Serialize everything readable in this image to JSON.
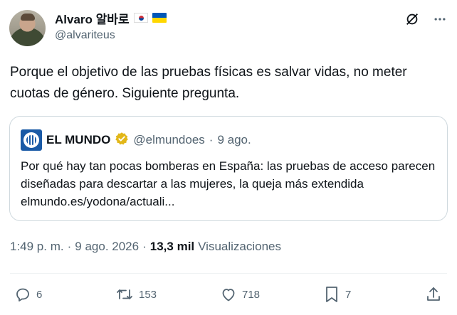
{
  "author": {
    "display_name": "Alvaro 알바로",
    "handle": "@alvariteus",
    "flags": [
      "south-korea-flag",
      "ukraine-flag"
    ]
  },
  "tweet": {
    "text": "Porque el objetivo de las pruebas físicas es salvar vidas, no meter cuotas de género. Siguiente pregunta."
  },
  "quoted": {
    "name": "EL MUNDO",
    "handle": "@elmundoes",
    "separator": "·",
    "date": "9 ago.",
    "text": "Por qué hay tan pocas bomberas en España: las pruebas de acceso parecen diseñadas para descartar a las mujeres, la queja más extendida elmundo.es/yodona/actuali..."
  },
  "meta": {
    "time": "1:49 p. m.",
    "sep1": "·",
    "date": "9 ago. 2026",
    "sep2": "·",
    "views_count": "13,3 mil",
    "views_label": "Visualizaciones"
  },
  "actions": {
    "replies": "6",
    "reposts": "153",
    "likes": "718",
    "bookmarks": "7"
  },
  "colors": {
    "text": "#0f1419",
    "secondary": "#536471",
    "border": "#cfd9de",
    "verified_gold": "#e2b719"
  }
}
